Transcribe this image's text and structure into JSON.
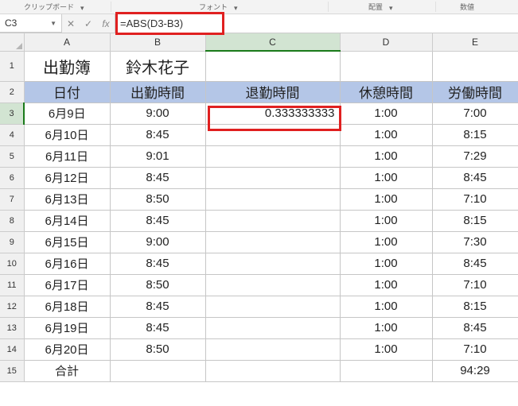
{
  "ribbon": {
    "group1": "クリップボード",
    "group2": "フォント",
    "group3": "配置",
    "group4": "数値"
  },
  "formula_bar": {
    "cell_ref": "C3",
    "formula": "=ABS(D3-B3)",
    "fx_label": "fx"
  },
  "columns": [
    "A",
    "B",
    "C",
    "D",
    "E"
  ],
  "row_numbers": [
    "1",
    "2",
    "3",
    "4",
    "5",
    "6",
    "7",
    "8",
    "9",
    "10",
    "11",
    "12",
    "13",
    "14",
    "15"
  ],
  "header_row1": {
    "A": "出勤簿",
    "B": "鈴木花子",
    "C": "",
    "D": "",
    "E": ""
  },
  "header_row2": {
    "A": "日付",
    "B": "出勤時間",
    "C": "退勤時間",
    "D": "休憩時間",
    "E": "労働時間"
  },
  "rows": [
    {
      "A": "6月9日",
      "B": "9:00",
      "C": "0.333333333",
      "D": "1:00",
      "E": "7:00"
    },
    {
      "A": "6月10日",
      "B": "8:45",
      "C": "",
      "D": "1:00",
      "E": "8:15"
    },
    {
      "A": "6月11日",
      "B": "9:01",
      "C": "",
      "D": "1:00",
      "E": "7:29"
    },
    {
      "A": "6月12日",
      "B": "8:45",
      "C": "",
      "D": "1:00",
      "E": "8:45"
    },
    {
      "A": "6月13日",
      "B": "8:50",
      "C": "",
      "D": "1:00",
      "E": "7:10"
    },
    {
      "A": "6月14日",
      "B": "8:45",
      "C": "",
      "D": "1:00",
      "E": "8:15"
    },
    {
      "A": "6月15日",
      "B": "9:00",
      "C": "",
      "D": "1:00",
      "E": "7:30"
    },
    {
      "A": "6月16日",
      "B": "8:45",
      "C": "",
      "D": "1:00",
      "E": "8:45"
    },
    {
      "A": "6月17日",
      "B": "8:50",
      "C": "",
      "D": "1:00",
      "E": "7:10"
    },
    {
      "A": "6月18日",
      "B": "8:45",
      "C": "",
      "D": "1:00",
      "E": "8:15"
    },
    {
      "A": "6月19日",
      "B": "8:45",
      "C": "",
      "D": "1:00",
      "E": "8:45"
    },
    {
      "A": "6月20日",
      "B": "8:50",
      "C": "",
      "D": "1:00",
      "E": "7:10"
    }
  ],
  "footer": {
    "A": "合計",
    "B": "",
    "C": "",
    "D": "",
    "E": "94:29"
  }
}
